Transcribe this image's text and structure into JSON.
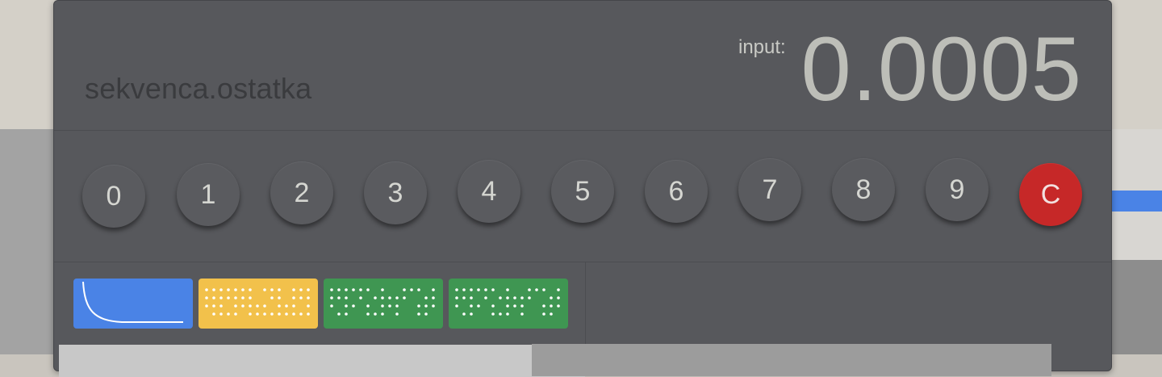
{
  "sequence": {
    "name": "sekvenca.ostatka"
  },
  "input": {
    "label": "input:",
    "value": "0.0005"
  },
  "keypad": {
    "digits": [
      "0",
      "1",
      "2",
      "3",
      "4",
      "5",
      "6",
      "7",
      "8",
      "9"
    ],
    "clear_label": "C"
  },
  "colors": {
    "panel": "#57585c",
    "clear_button": "#c62828",
    "thumb_blue": "#4a83e6",
    "thumb_yellow": "#f2c14b",
    "thumb_green": "#3f9652"
  },
  "thumbnails": [
    {
      "kind": "curve",
      "color": "#4a83e6"
    },
    {
      "kind": "dots",
      "color": "#f2c14b"
    },
    {
      "kind": "dots",
      "color": "#3f9652"
    },
    {
      "kind": "dots",
      "color": "#3f9652"
    }
  ]
}
